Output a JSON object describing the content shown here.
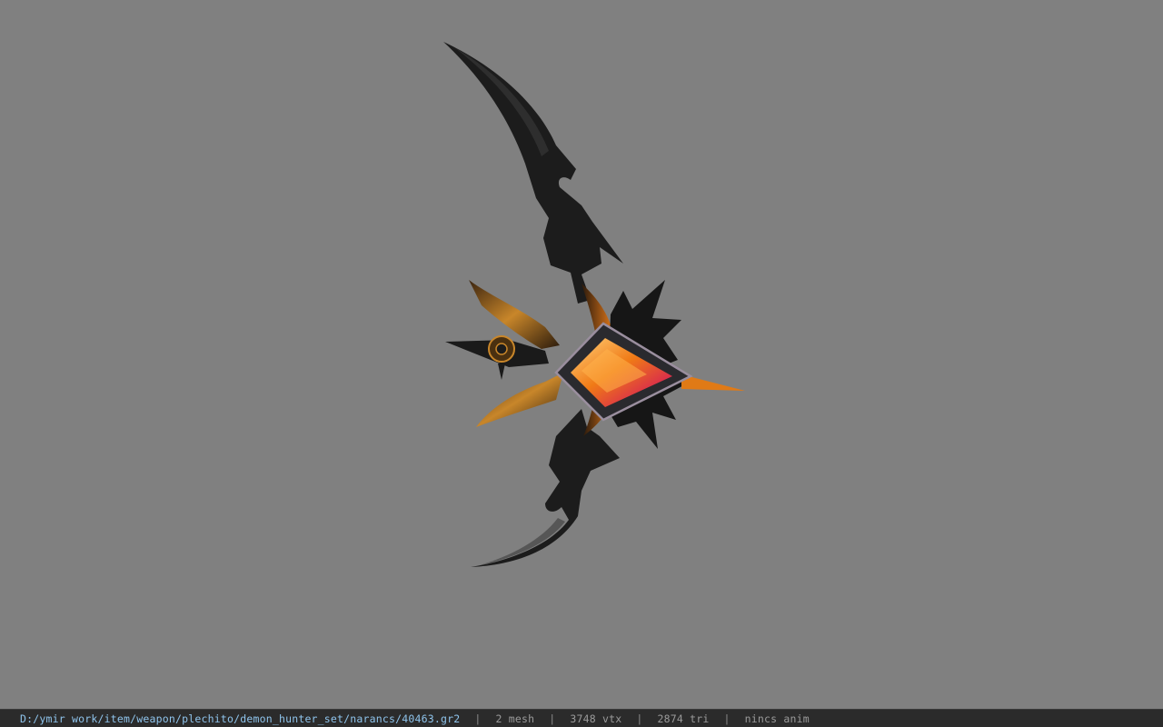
{
  "viewport": {
    "background": "#808080",
    "model_name": "demon-hunter-bow",
    "accent_colors": [
      "#1b1b1b",
      "#e06a12",
      "#c8862a",
      "#d9274a"
    ]
  },
  "statusbar": {
    "path": "D:/ymir work/item/weapon/plechito/demon_hunter_set/narancs/40463.gr2",
    "separator": "|",
    "mesh": "2 mesh",
    "vtx": "3748 vtx",
    "tri": "2874 tri",
    "anim": "nincs anim"
  }
}
